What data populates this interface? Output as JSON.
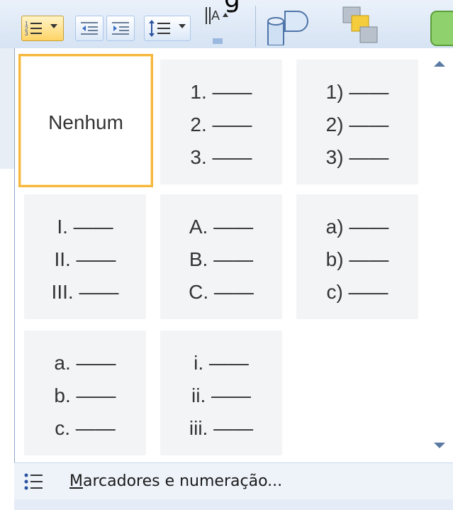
{
  "toolbar": {
    "title_fragment": "g",
    "buttons": [
      {
        "icon": "numbering-icon"
      },
      {
        "icon": "decrease-indent-icon"
      },
      {
        "icon": "increase-indent-icon"
      },
      {
        "icon": "line-spacing-icon"
      },
      {
        "icon": "text-direction-icon"
      },
      {
        "icon": "shapes-icon"
      },
      {
        "icon": "arrange-icon"
      },
      {
        "icon": "quick-styles-icon"
      }
    ]
  },
  "gallery": {
    "none_label": "Nenhum",
    "styles": [
      {
        "items": [
          "1. ——",
          "2. ——",
          "3. ——"
        ]
      },
      {
        "items": [
          "1) ——",
          "2) ——",
          "3) ——"
        ]
      },
      {
        "items": [
          "I. ——",
          "II. ——",
          "III. ——"
        ]
      },
      {
        "items": [
          "A. ——",
          "B. ——",
          "C. ——"
        ]
      },
      {
        "items": [
          "a) ——",
          "b) ——",
          "c) ——"
        ]
      },
      {
        "items": [
          "a. ——",
          "b. ——",
          "c. ——"
        ]
      },
      {
        "items": [
          "i. ——",
          "ii. ——",
          "iii. ——"
        ]
      }
    ]
  },
  "footer": {
    "label_mnemonic": "M",
    "label_rest": "arcadores e numeração...",
    "icon": "bullets-icon"
  },
  "colors": {
    "selection_border": "#f6b73c",
    "cell_background": "#f3f4f6",
    "accent_blue": "#5a7aa3"
  }
}
